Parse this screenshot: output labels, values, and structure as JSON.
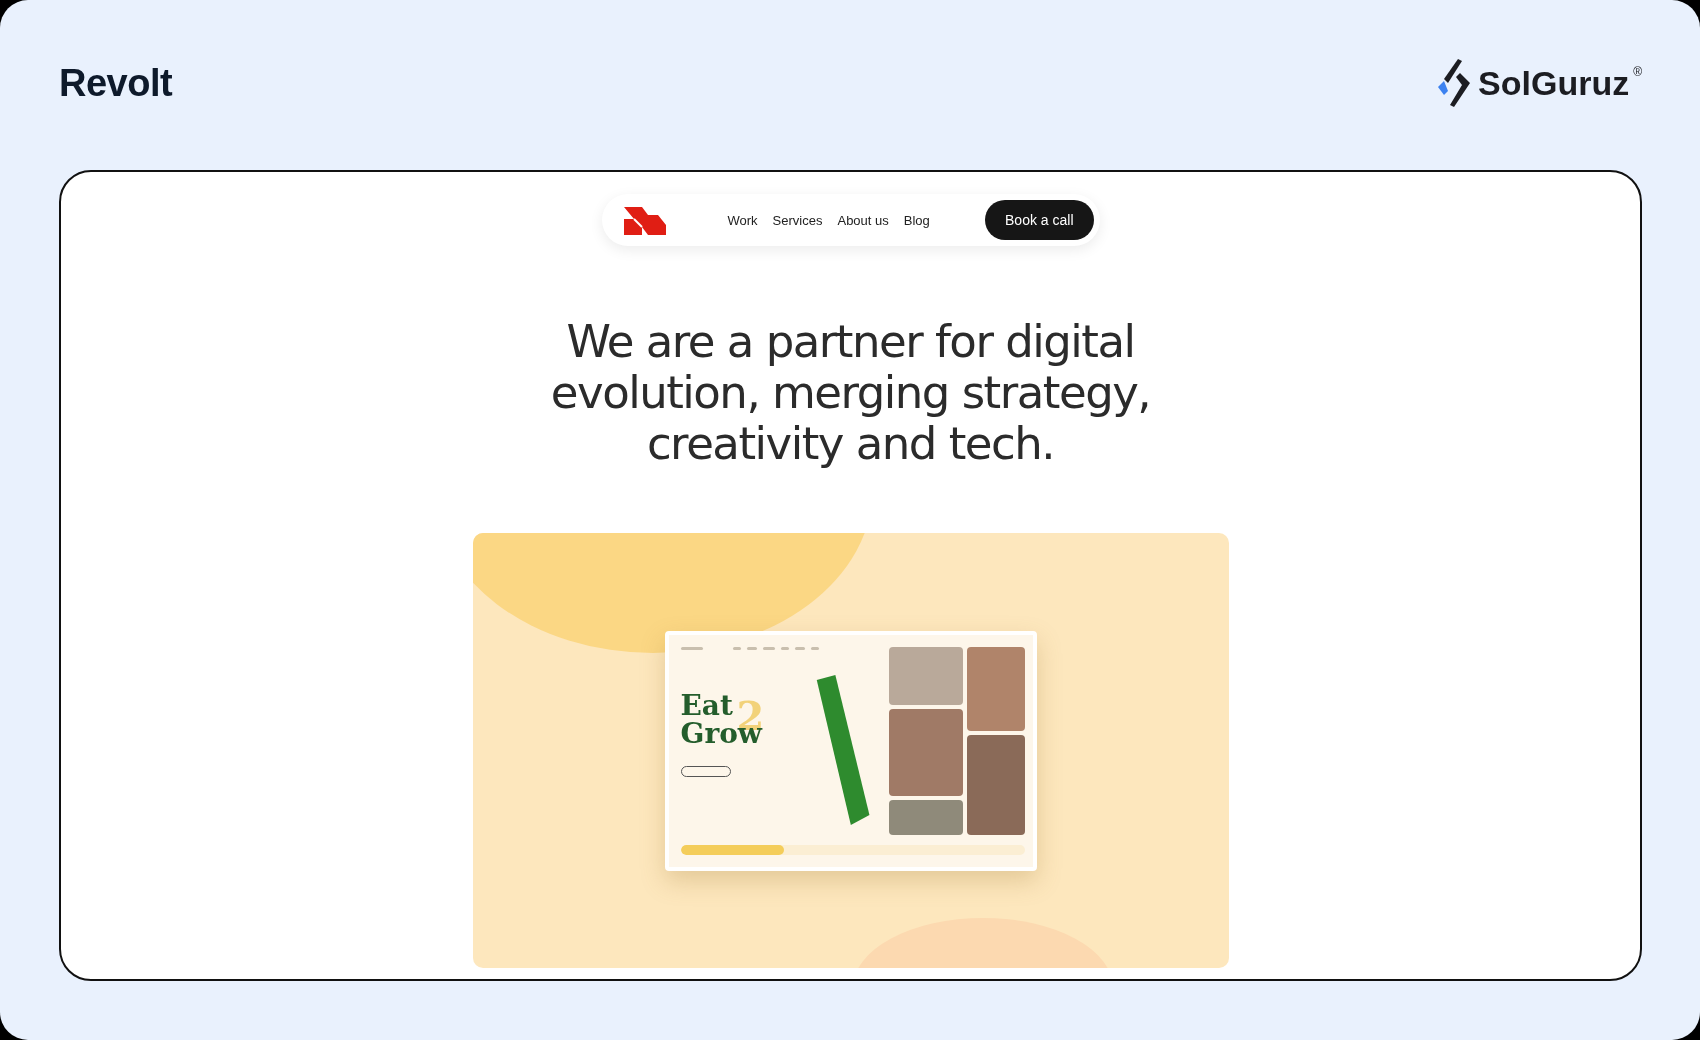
{
  "header": {
    "title": "Revolt",
    "brand": {
      "name": "SolGuruz",
      "mark": "®"
    }
  },
  "nav": {
    "links": [
      "Work",
      "Services",
      "About us",
      "Blog"
    ],
    "cta": "Book a call"
  },
  "headline": [
    "We are a partner for digital",
    "evolution, merging strategy,",
    "creativity and tech."
  ],
  "showcase": {
    "hero_words": [
      "Eat",
      "2",
      "Grow"
    ],
    "progress": {
      "level": 0.3
    }
  }
}
